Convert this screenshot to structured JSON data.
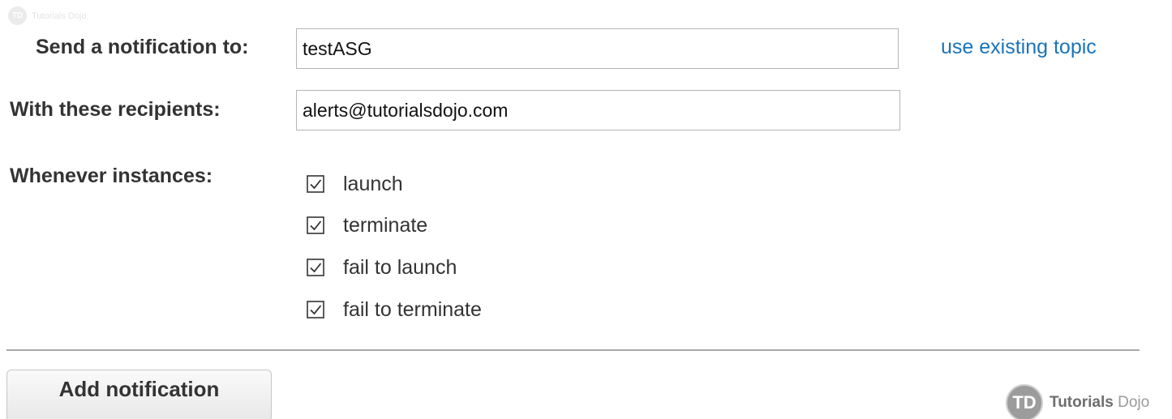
{
  "watermark_top": {
    "badge": "TD",
    "text": "Tutorials Dojo"
  },
  "form": {
    "send_label": "Send a notification to:",
    "send_value": "testASG",
    "use_existing_link": "use existing topic",
    "recipients_label": "With these recipients:",
    "recipients_value": "alerts@tutorialsdojo.com",
    "instances_label": "Whenever instances:",
    "options": [
      {
        "label": "launch",
        "checked": true
      },
      {
        "label": "terminate",
        "checked": true
      },
      {
        "label": "fail to launch",
        "checked": true
      },
      {
        "label": "fail to terminate",
        "checked": true
      }
    ]
  },
  "actions": {
    "add_notification": "Add notification"
  },
  "brand": {
    "badge": "TD",
    "name_a": "Tutorials",
    "name_b": "Dojo"
  },
  "colors": {
    "link": "#1a73b9",
    "text": "#333333",
    "border": "#b5b5b5"
  }
}
